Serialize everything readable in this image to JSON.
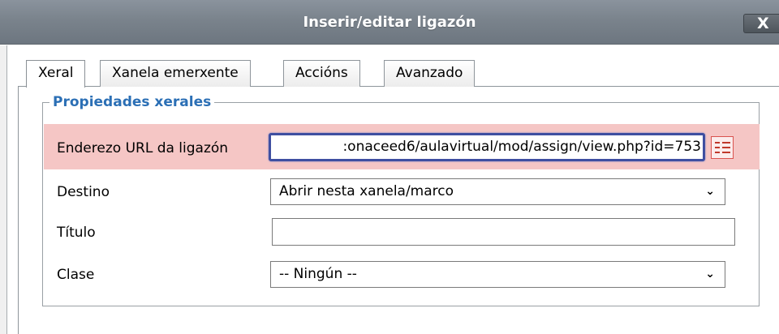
{
  "dialog": {
    "title": "Inserir/editar ligazón",
    "close_label": "X"
  },
  "tabs": [
    {
      "label": "Xeral",
      "active": true
    },
    {
      "label": "Xanela emerxente",
      "active": false
    },
    {
      "label": "Accións",
      "active": false
    },
    {
      "label": "Avanzado",
      "active": false
    }
  ],
  "group": {
    "legend": "Propiedades xerales"
  },
  "fields": {
    "url": {
      "label": "Enderezo URL da ligazón",
      "value": ":onaceed6/aulavirtual/mod/assign/view.php?id=753"
    },
    "target": {
      "label": "Destino",
      "selected": "Abrir nesta xanela/marco"
    },
    "title": {
      "label": "Título",
      "value": ""
    },
    "class": {
      "label": "Clase",
      "selected": "-- Ningún --"
    }
  },
  "icons": {
    "browse": "file-browser-icon",
    "chevron": "chevron-down-icon",
    "close": "close-icon"
  },
  "colors": {
    "titlebar": "#7a838c",
    "legend": "#2b6fb5",
    "highlight_row": "#f5c6c5",
    "focus_border": "#3f4fa1"
  }
}
